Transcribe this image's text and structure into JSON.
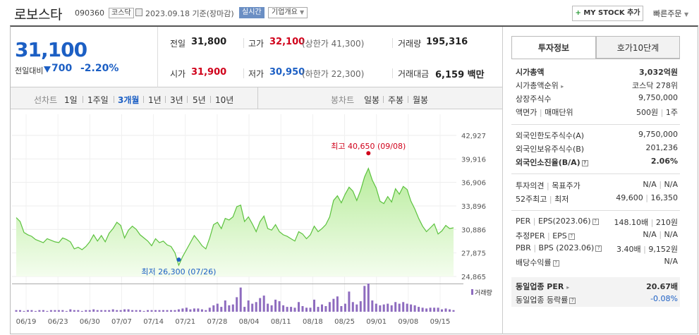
{
  "header": {
    "stock_name": "로보스타",
    "stock_code": "090360",
    "market_tag": "코스닥",
    "date": "2023.09.18 기준(장마감)",
    "realtime_label": "실시간",
    "company_label": "기업개요",
    "mystock_plus": "+",
    "mystock_label": "MY STOCK 추가",
    "quick_order": "빠른주문"
  },
  "price": {
    "current": "31,100",
    "change_label": "전일대비",
    "change_value": "700",
    "change_pct": "-2.20%"
  },
  "quote": {
    "prev_label": "전일",
    "prev_value": "31,800",
    "high_label": "고가",
    "high_value": "32,100",
    "upper_limit": "(상한가 41,300)",
    "volume_label": "거래량",
    "volume_value": "195,316",
    "open_label": "시가",
    "open_value": "31,900",
    "low_label": "저가",
    "low_value": "30,950",
    "lower_limit": "(하한가 22,300)",
    "amount_label": "거래대금",
    "amount_value": "6,159 백만"
  },
  "chart_tabs": {
    "line_label": "선차트",
    "line_periods": [
      "1일",
      "1주일",
      "3개월",
      "1년",
      "3년",
      "5년",
      "10년"
    ],
    "selected_period": "3개월",
    "candle_label": "봉차트",
    "candle_periods": [
      "일봉",
      "주봉",
      "월봉"
    ]
  },
  "chart_data": {
    "type": "area",
    "y_ticks": [
      "42,927",
      "39,916",
      "36,906",
      "33,896",
      "30,886",
      "27,875",
      "24,865"
    ],
    "ylim": [
      24865,
      42927
    ],
    "x_ticks": [
      "06/19",
      "06/23",
      "06/30",
      "07/07",
      "07/14",
      "07/21",
      "07/28",
      "08/04",
      "08/11",
      "08/18",
      "08/25",
      "09/01",
      "09/08",
      "09/15"
    ],
    "high_annotation": "최고 40,650 (09/08)",
    "low_annotation": "최저 26,300 (07/26)",
    "volume_legend": "거래량",
    "series": [
      {
        "values": [
          32400,
          31900,
          30500,
          30200,
          30000,
          29600,
          29400,
          29200,
          29700,
          29500,
          29300,
          29200,
          29800,
          29600,
          29300,
          28400,
          28600,
          28300,
          28700,
          29300,
          30200,
          29400,
          30100,
          29300,
          30400,
          31000,
          31800,
          31400,
          29800,
          30800,
          31300,
          30900,
          30200,
          29800,
          29400,
          28800,
          29700,
          29200,
          29400,
          28900,
          28700,
          27900,
          26300,
          27400,
          28300,
          29200,
          30100,
          29500,
          28800,
          28400,
          29800,
          31500,
          31800,
          31000,
          32300,
          32100,
          32500,
          33800,
          34000,
          31900,
          32500,
          31600,
          30600,
          31900,
          32600,
          31000,
          30800,
          31500,
          30600,
          30200,
          30000,
          29700,
          29400,
          30600,
          30300,
          29700,
          30200,
          31300,
          30600,
          31000,
          31500,
          32500,
          34600,
          35200,
          34300,
          35400,
          36300,
          35800,
          34600,
          35900,
          37600,
          38700,
          37200,
          36200,
          34500,
          34200,
          35100,
          34400,
          36100,
          35400,
          36400,
          36000,
          34500,
          33500,
          32300,
          31300,
          30600,
          31100,
          31600,
          30300,
          30700,
          31400,
          31000,
          31100
        ]
      },
      {
        "values": [
          0.02,
          0.02,
          0.01,
          0.02,
          0.02,
          0.01,
          0.02,
          0.02,
          0.01,
          0.02,
          0.02,
          0.02,
          0.02,
          0.01,
          0.03,
          0.02,
          0.02,
          0.01,
          0.02,
          0.02,
          0.03,
          0.02,
          0.02,
          0.02,
          0.02,
          0.03,
          0.02,
          0.02,
          0.03,
          0.03,
          0.02,
          0.02,
          0.02,
          0.01,
          0.02,
          0.02,
          0.02,
          0.02,
          0.02,
          0.02,
          0.02,
          0.02,
          0.03,
          0.04,
          0.05,
          0.03,
          0.04,
          0.04,
          0.03,
          0.02,
          0.05,
          0.08,
          0.1,
          0.06,
          0.14,
          0.08,
          0.09,
          0.18,
          0.3,
          0.06,
          0.14,
          0.1,
          0.12,
          0.17,
          0.2,
          0.1,
          0.08,
          0.15,
          0.13,
          0.08,
          0.06,
          0.06,
          0.05,
          0.12,
          0.07,
          0.05,
          0.05,
          0.15,
          0.06,
          0.09,
          0.07,
          0.12,
          0.16,
          0.19,
          0.07,
          0.1,
          0.25,
          0.12,
          0.09,
          0.13,
          0.32,
          0.35,
          0.14,
          0.1,
          0.08,
          0.09,
          0.1,
          0.08,
          0.12,
          0.1,
          0.12,
          0.1,
          0.09,
          0.08,
          0.06,
          0.05,
          0.04,
          0.05,
          0.05,
          0.05,
          0.03,
          0.04,
          0.03,
          0.02
        ]
      }
    ],
    "grid": true
  },
  "info": {
    "tab_invest": "투자정보",
    "tab_orderbook": "호가10단계",
    "rows": [
      {
        "label": "시가총액",
        "value": "3,032억원"
      },
      {
        "label": "시가총액순위",
        "value": "코스닥 278위"
      },
      {
        "label": "상장주식수",
        "value": "9,750,000"
      },
      {
        "label": "액면가",
        "label2": "매매단위",
        "value": "500원",
        "value2": "1주"
      },
      {
        "label": "외국인한도주식수(A)",
        "value": "9,750,000"
      },
      {
        "label": "외국인보유주식수(B)",
        "value": "201,236"
      },
      {
        "label": "외국인소진율(B/A)",
        "value": "2.06%",
        "qm": "?"
      },
      {
        "label": "투자의견",
        "label2": "목표주가",
        "value": "N/A",
        "value2": "N/A"
      },
      {
        "label": "52주최고",
        "label2": "최저",
        "value": "49,600",
        "value2": "16,350"
      },
      {
        "label": "PER",
        "label2": "EPS(2023.06)",
        "value": "148.10배",
        "value2": "210원",
        "qm": "?"
      },
      {
        "label": "추정PER",
        "label2": "EPS",
        "value": "N/A",
        "value2": "N/A",
        "qm": "?"
      },
      {
        "label": "PBR",
        "label2": "BPS (2023.06)",
        "value": "3.40배",
        "value2": "9,152원",
        "qm": "?"
      },
      {
        "label": "배당수익률",
        "value": "N/A",
        "qm": "?"
      },
      {
        "label": "동일업종 PER",
        "value": "20.67배"
      },
      {
        "label": "동일업종 등락률",
        "value": "-0.08%",
        "qm": "?"
      }
    ]
  },
  "colors": {
    "up": "#d0021b",
    "down": "#1c5fc4",
    "line": "#5cc23e",
    "volume": "#8e6cbf"
  }
}
